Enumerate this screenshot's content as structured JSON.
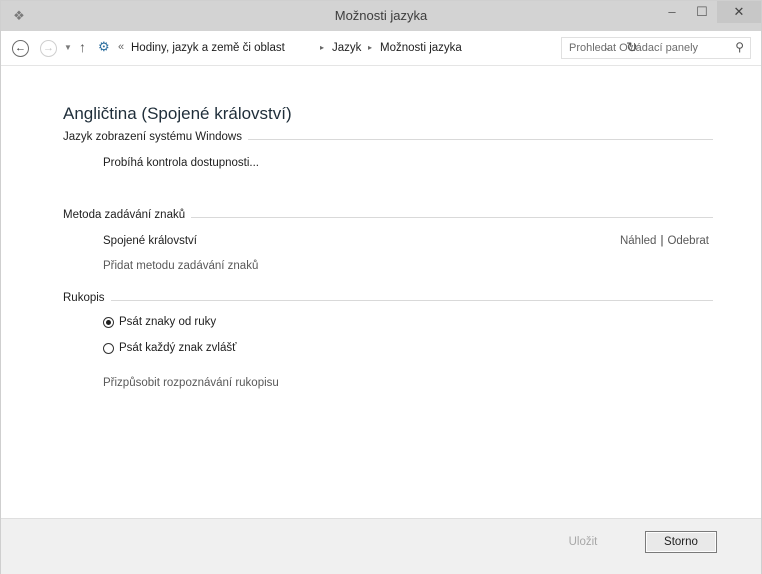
{
  "window": {
    "title": "Možnosti jazyka",
    "icons": {
      "app": "language-settings-icon",
      "minimize": "minimize-icon",
      "maximize": "maximize-icon",
      "close": "close-icon"
    }
  },
  "navbar": {
    "overflow": "«",
    "breadcrumbs": [
      "Hodiny, jazyk a země či oblast",
      "Jazyk",
      "Možnosti jazyka"
    ],
    "search_placeholder": "Prohledat Ovládací panely"
  },
  "content": {
    "language_title": "Angličtina (Spojené království)",
    "display_section": "Jazyk zobrazení systému Windows",
    "display_status": "Probíhá kontrola dostupnosti...",
    "input_section": "Metoda zadávání znaků",
    "input_method": "Spojené království",
    "preview_link": "Náhled",
    "remove_link": "Odebrat",
    "add_input_link": "Přidat metodu zadávání znaků",
    "handwriting_section": "Rukopis",
    "radio_freehand": "Psát znaky od ruky",
    "radio_each": "Psát každý znak zvlášť",
    "radio_selected": "freehand",
    "personalize_link": "Přizpůsobit rozpoznávání rukopisu"
  },
  "footer": {
    "save_label": "Uložit",
    "cancel_label": "Storno"
  },
  "colors": {
    "titlebar": "#d3d3d3",
    "footer": "#f0f0f0",
    "link": "#595959"
  }
}
